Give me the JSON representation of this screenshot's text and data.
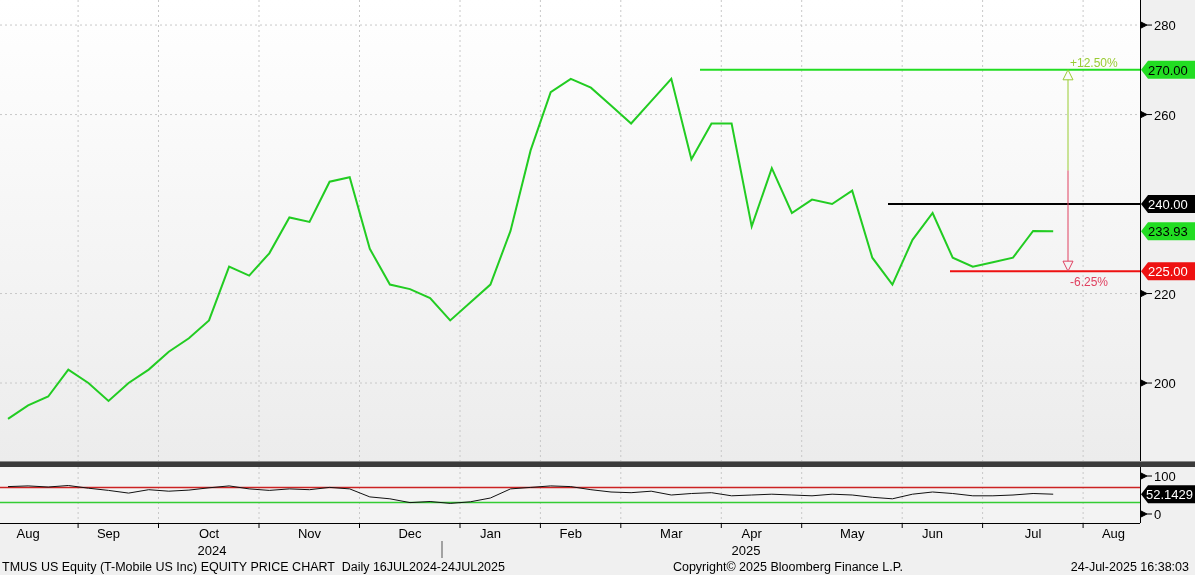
{
  "price_chart": {
    "chart_data": {
      "type": "line",
      "series": [
        {
          "color": "#22cc22",
          "values": [
            192,
            195,
            197,
            203,
            200,
            196,
            200,
            203,
            207,
            210,
            214,
            226,
            224,
            229,
            237,
            236,
            245,
            246,
            230,
            222,
            221,
            219,
            214,
            218,
            222,
            234,
            252,
            265,
            268,
            266,
            262,
            258,
            263,
            268,
            250,
            258,
            258,
            235,
            248,
            238,
            241,
            240,
            243,
            228,
            222,
            232,
            238,
            228,
            226,
            227,
            228,
            234,
            233.9,
            null,
            null,
            null,
            null
          ]
        }
      ],
      "ylim": [
        182.8,
        285.6
      ],
      "yticks": [
        200,
        220,
        260,
        280
      ],
      "grid": true,
      "ref_lines": [
        {
          "axis": "y",
          "value": 270,
          "label": "270.00",
          "color": "#22dd22"
        },
        {
          "axis": "y",
          "value": 240,
          "label": "240.00",
          "color": "#000000"
        },
        {
          "axis": "y",
          "value": 225,
          "label": "225.00",
          "color": "#ee1111"
        }
      ]
    },
    "last_price": {
      "label": "233.93",
      "color": "#22dd22"
    },
    "range_labels": {
      "up": "+12.50%",
      "down": "-6.25%"
    }
  },
  "rsi_chart": {
    "chart_data": {
      "type": "line",
      "categories": [
        null,
        "Aug",
        null,
        null,
        null,
        "Sep",
        null,
        null,
        null,
        null,
        "Oct",
        null,
        null,
        null,
        null,
        "Nov",
        null,
        null,
        null,
        null,
        "Dec",
        null,
        null,
        null,
        "Jan",
        null,
        null,
        null,
        "Feb",
        null,
        null,
        null,
        null,
        "Mar",
        null,
        null,
        null,
        "Apr",
        null,
        null,
        null,
        null,
        "May",
        null,
        null,
        null,
        "Jun",
        null,
        null,
        null,
        null,
        "Jul",
        null,
        null,
        null,
        "Aug",
        null
      ],
      "series": [
        {
          "color": "#111111",
          "values": [
            72,
            74,
            71,
            75,
            68,
            62,
            55,
            64,
            60,
            63,
            69,
            74,
            66,
            62,
            66,
            64,
            70,
            66,
            45,
            40,
            30,
            33,
            28,
            32,
            42,
            66,
            70,
            74,
            72,
            64,
            58,
            56,
            60,
            50,
            54,
            56,
            48,
            50,
            52,
            50,
            48,
            52,
            50,
            44,
            40,
            52,
            58,
            54,
            48,
            48,
            50,
            54,
            52,
            null,
            null,
            null,
            null
          ]
        }
      ],
      "ylim": [
        -23.7,
        123.7
      ],
      "yticks": [
        0,
        100
      ],
      "grid": true,
      "ref_lines": [
        {
          "axis": "y",
          "value": 70,
          "color": "#cc2222"
        },
        {
          "axis": "y",
          "value": 30,
          "color": "#33cc33"
        }
      ]
    },
    "last_value": {
      "label": "52.1429",
      "color": "#000000"
    }
  },
  "year_labels": [
    "2024",
    "2025"
  ],
  "footer": {
    "description": "TMUS US Equity (T-Mobile US Inc) EQUITY PRICE CHART  Daily 16JUL2024-24JUL2025",
    "copyright": "Copyright© 2025 Bloomberg Finance L.P.",
    "timestamp": "24-Jul-2025 16:38:03"
  }
}
